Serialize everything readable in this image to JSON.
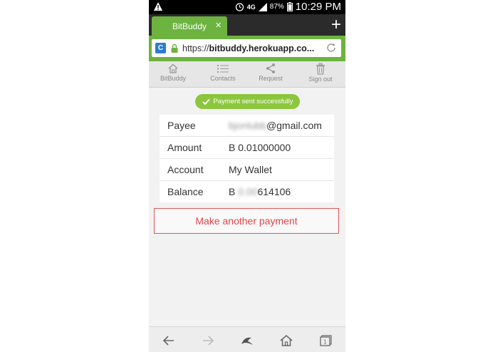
{
  "status_bar": {
    "network": "4G",
    "battery": "87%",
    "time": "10:29 PM"
  },
  "browser": {
    "tab_title": "BitBuddy",
    "tab_close": "×",
    "new_tab": "+",
    "site_icon": "C",
    "url_prefix": "https://",
    "url_host": "bitbuddy.herokuapp.co..."
  },
  "app_nav": {
    "items": [
      {
        "label": "BitBuddy",
        "icon": "home-icon"
      },
      {
        "label": "Contacts",
        "icon": "list-icon"
      },
      {
        "label": "Request",
        "icon": "share-icon"
      },
      {
        "label": "Sign out",
        "icon": "trash-icon"
      }
    ]
  },
  "success_badge": "Payment sent successfully",
  "details": {
    "rows": [
      {
        "label": "Payee",
        "value_hidden": "bjonlubb",
        "value": "@gmail.com"
      },
      {
        "label": "Amount",
        "value": "B 0.01000000"
      },
      {
        "label": "Account",
        "value": "My Wallet"
      },
      {
        "label": "Balance",
        "value_prefix": "B ",
        "value_hidden": "0.00",
        "value": "614106"
      }
    ]
  },
  "make_another_button": "Make another payment",
  "colors": {
    "brand_green": "#6db33f",
    "badge_green": "#8cc63e",
    "button_red": "#e0474c"
  }
}
